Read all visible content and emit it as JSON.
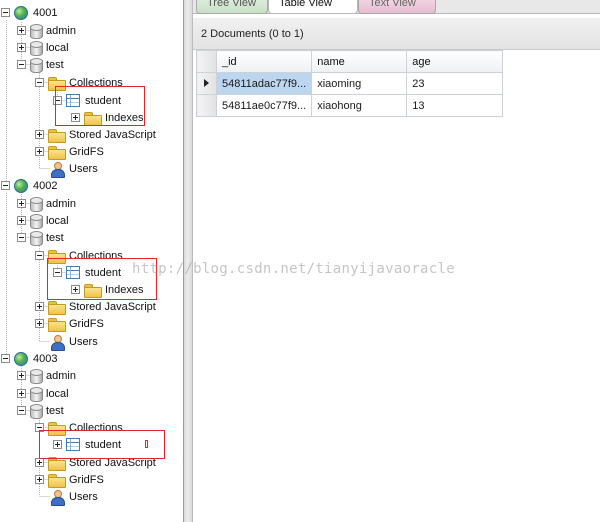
{
  "tree": {
    "servers": [
      {
        "label": "4001",
        "databases": [
          {
            "label": "admin"
          },
          {
            "label": "local"
          },
          {
            "label": "test",
            "collections_label": "Collections",
            "collection": "student",
            "indexes_label": "Indexes",
            "stored_js_label": "Stored JavaScript",
            "gridfs_label": "GridFS",
            "users_label": "Users"
          }
        ]
      },
      {
        "label": "4002",
        "databases": [
          {
            "label": "admin"
          },
          {
            "label": "local"
          },
          {
            "label": "test",
            "collections_label": "Collections",
            "collection": "student",
            "indexes_label": "Indexes",
            "stored_js_label": "Stored JavaScript",
            "gridfs_label": "GridFS",
            "users_label": "Users"
          }
        ]
      },
      {
        "label": "4003",
        "databases": [
          {
            "label": "admin"
          },
          {
            "label": "local"
          },
          {
            "label": "test",
            "collections_label": "Collections",
            "collection": "student",
            "stored_js_label": "Stored JavaScript",
            "gridfs_label": "GridFS",
            "users_label": "Users"
          }
        ]
      }
    ]
  },
  "tabs": {
    "tree_view": "Tree View",
    "table_view": "Table View",
    "text_view": "Text View",
    "active": "Table View"
  },
  "results": {
    "summary": "2 Documents (0 to 1)",
    "columns": [
      "_id",
      "name",
      "age"
    ],
    "rows": [
      {
        "id": "54811adac77f9...",
        "name": "xiaoming",
        "age": "23"
      },
      {
        "id": "54811ae0c77f9...",
        "name": "xiaohong",
        "age": "13"
      }
    ]
  },
  "watermark": "http://blog.csdn.net/tianyijavaoracle",
  "colors": {
    "highlight_box": "#e0282a",
    "selected_cell": "#bcd6f0",
    "tree_tab": "#c8e0c6",
    "text_tab": "#e7bdd1"
  }
}
